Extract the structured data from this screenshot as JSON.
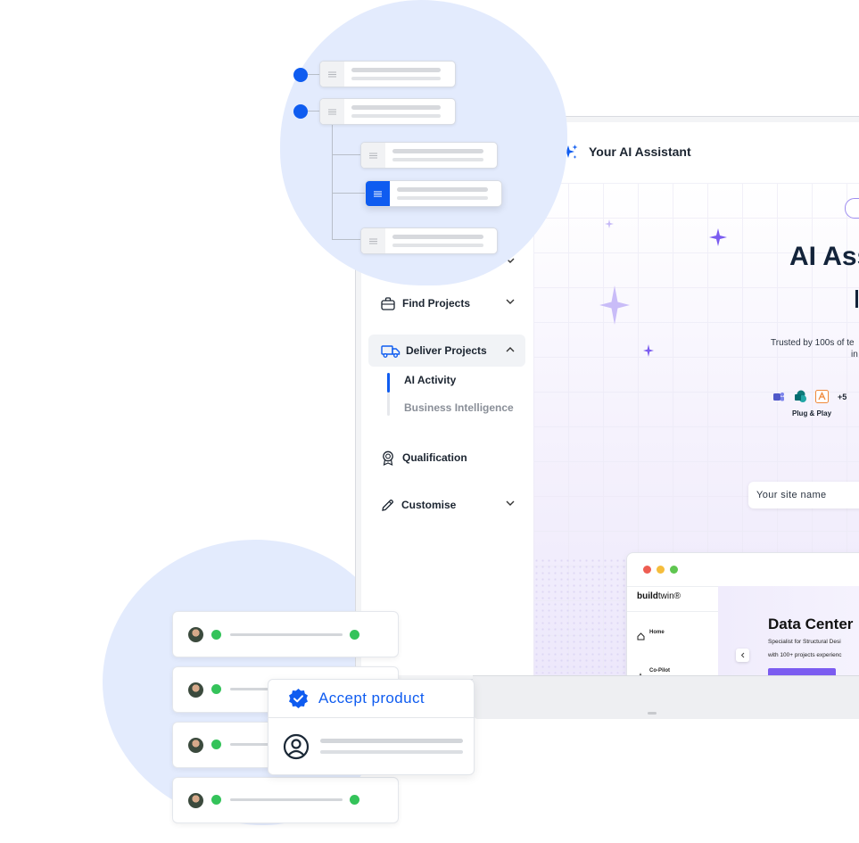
{
  "assistant": {
    "title": "Your AI Assistant"
  },
  "sidebar": {
    "items": [
      {
        "label": "Find Projects"
      },
      {
        "label": "Deliver Projects"
      },
      {
        "label": "Qualification"
      },
      {
        "label": "Customise"
      }
    ],
    "sub_items": [
      {
        "label": "AI Activity"
      },
      {
        "label": "Business Intelligence"
      }
    ]
  },
  "hero": {
    "heading": "AI Ass",
    "trusted_text": "Trusted by 100s of te",
    "trusted_text_2": "in",
    "integrations_more": "+5",
    "plug_label": "Plug & Play",
    "site_name_placeholder": "Your site name"
  },
  "preview": {
    "logo_bold": "build",
    "logo_rest": "twin®",
    "nav_home": "Home",
    "nav_copilot": "Co-Pilot",
    "title": "Data Center",
    "line1": "Specialist for Structural Desi",
    "line2": "with 100+ projects experienc"
  },
  "accept_card": {
    "label": "Accept product"
  },
  "colors": {
    "accent": "#0f5cf0",
    "status_green": "#34c35a",
    "blob": "#e3ebfd",
    "sparkle": "#7b5cf0"
  }
}
